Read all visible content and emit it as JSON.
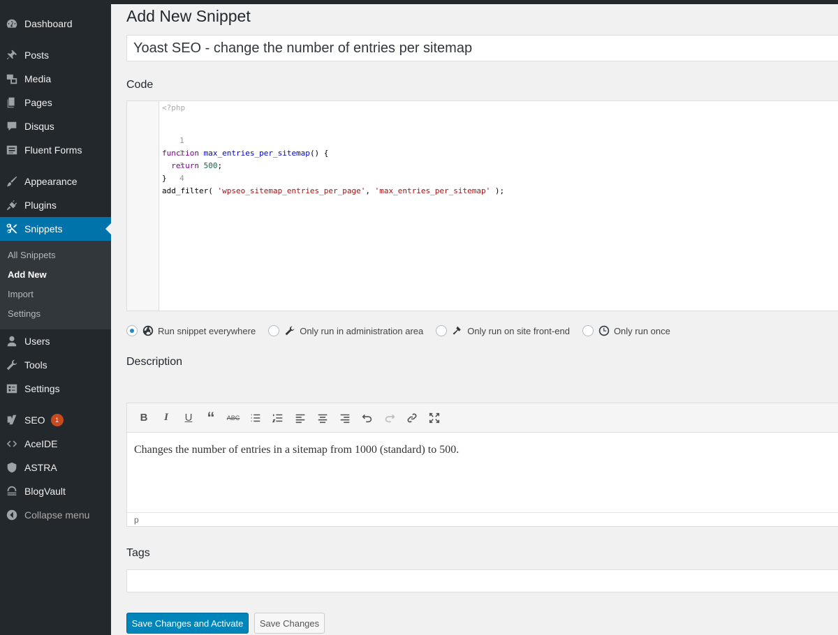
{
  "sidebar": {
    "items": [
      {
        "label": "Dashboard",
        "icon": "dashboard-icon"
      },
      {
        "label": "Posts",
        "icon": "pin-icon"
      },
      {
        "label": "Media",
        "icon": "media-icon"
      },
      {
        "label": "Pages",
        "icon": "pages-icon"
      },
      {
        "label": "Disqus",
        "icon": "comment-icon"
      },
      {
        "label": "Fluent Forms",
        "icon": "forms-icon"
      },
      {
        "label": "Appearance",
        "icon": "brush-icon"
      },
      {
        "label": "Plugins",
        "icon": "plugin-icon"
      },
      {
        "label": "Snippets",
        "icon": "scissors-icon"
      },
      {
        "label": "Users",
        "icon": "users-icon"
      },
      {
        "label": "Tools",
        "icon": "wrench-icon"
      },
      {
        "label": "Settings",
        "icon": "settings-icon"
      },
      {
        "label": "SEO",
        "icon": "yoast-icon",
        "badge": "1"
      },
      {
        "label": "AceIDE",
        "icon": "code-icon"
      },
      {
        "label": "ASTRA",
        "icon": "shield-icon"
      },
      {
        "label": "BlogVault",
        "icon": "vault-icon"
      },
      {
        "label": "Collapse menu",
        "icon": "collapse-icon"
      }
    ],
    "submenu": [
      "All Snippets",
      "Add New",
      "Import",
      "Settings"
    ],
    "accent": "#0073aa"
  },
  "page": {
    "title": "Add New Snippet",
    "snippet_name": "Yoast SEO - change the number of entries per sitemap",
    "code_label": "Code",
    "description_label": "Description",
    "tags_label": "Tags"
  },
  "code": {
    "php_tag": "<?php",
    "lines": [
      {
        "n": "1",
        "text": "function max_entries_per_sitemap() {"
      },
      {
        "n": "2",
        "text": "  return 500;"
      },
      {
        "n": "3",
        "text": "}"
      },
      {
        "n": "4",
        "text": "add_filter( 'wpseo_sitemap_entries_per_page', 'max_entries_per_sitemap' );"
      }
    ]
  },
  "scope": {
    "options": [
      {
        "label": "Run snippet everywhere",
        "icon": "globe-icon",
        "checked": true
      },
      {
        "label": "Only run in administration area",
        "icon": "wrench-icon",
        "checked": false
      },
      {
        "label": "Only run on site front-end",
        "icon": "hammer-icon",
        "checked": false
      },
      {
        "label": "Only run once",
        "icon": "clock-icon",
        "checked": false
      }
    ]
  },
  "description": {
    "text": "Changes the number of entries in a sitemap from 1000 (standard) to 500.",
    "status": "p",
    "toolbar": [
      "bold-icon",
      "italic-icon",
      "underline-icon",
      "blockquote-icon",
      "strikethrough-icon",
      "bullet-list-icon",
      "numbered-list-icon",
      "align-left-icon",
      "align-center-icon",
      "align-right-icon",
      "undo-icon",
      "redo-icon",
      "link-icon",
      "fullscreen-icon"
    ]
  },
  "buttons": {
    "save_activate": "Save Changes and Activate",
    "save": "Save Changes"
  }
}
